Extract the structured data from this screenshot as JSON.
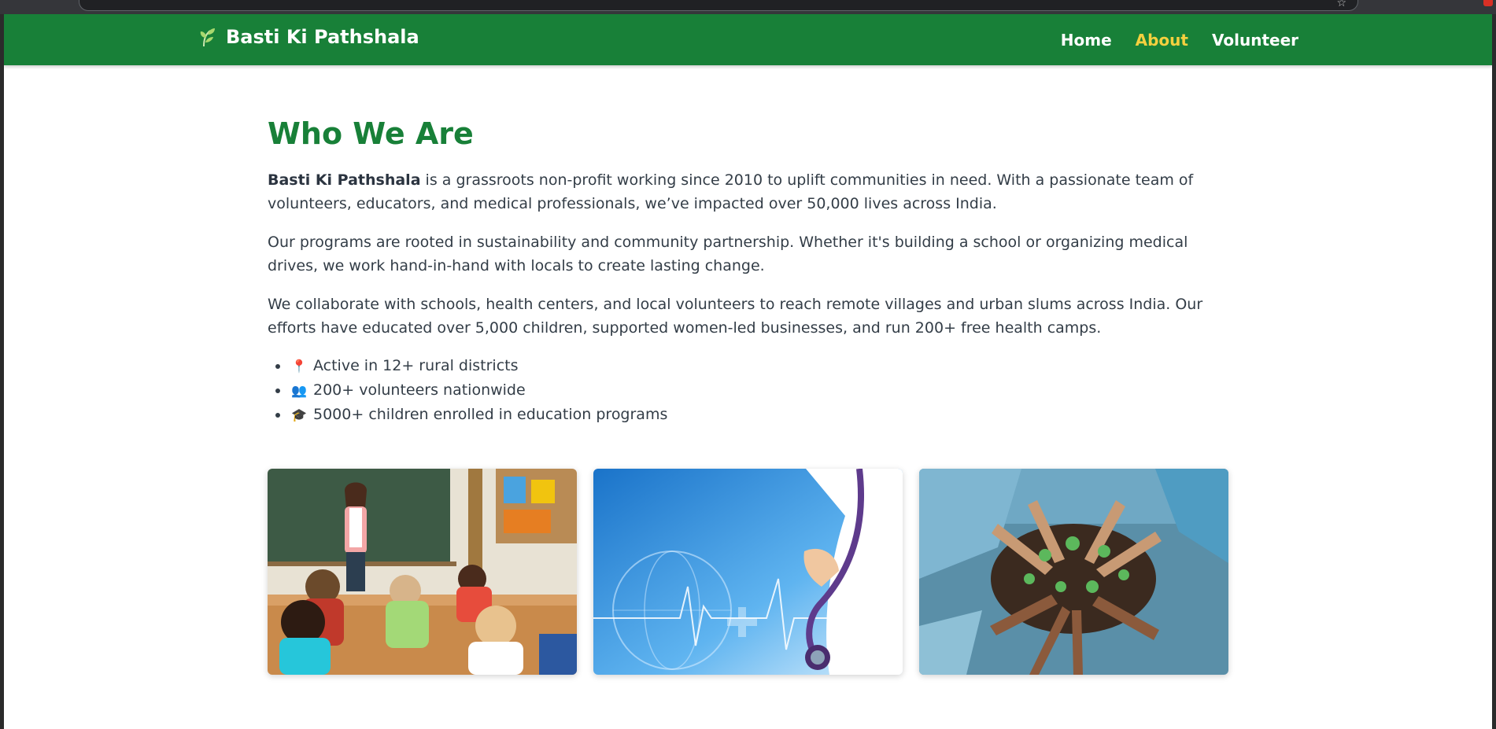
{
  "site": {
    "brand_name": "Basti Ki Pathshala",
    "brand_color": "#188038",
    "accent_color": "#f4d03f",
    "nav": [
      {
        "label": "Home",
        "active": false
      },
      {
        "label": "About",
        "active": true
      },
      {
        "label": "Volunteer",
        "active": false
      }
    ]
  },
  "about": {
    "heading": "Who We Are",
    "intro_bold": "Basti Ki Pathshala",
    "intro_rest": " is a grassroots non-profit working since 2010 to uplift communities in need. With a passionate team of volunteers, educators, and medical professionals, we’ve impacted over 50,000 lives across India.",
    "para2": "Our programs are rooted in sustainability and community partnership. Whether it's building a school or organizing medical drives, we work hand-in-hand with locals to create lasting change.",
    "para3": "We collaborate with schools, health centers, and local volunteers to reach remote villages and urban slums across India. Our efforts have educated over 5,000 children, supported women-led businesses, and run 200+ free health camps.",
    "highlights": [
      {
        "icon": "pin-icon",
        "emoji": "📍",
        "text": "Active in 12+ rural districts"
      },
      {
        "icon": "people-icon",
        "emoji": "👥",
        "text": "200+ volunteers nationwide"
      },
      {
        "icon": "graduation-cap-icon",
        "emoji": "🎓",
        "text": "5000+ children enrolled in education programs"
      }
    ]
  },
  "gallery": [
    {
      "name": "classroom-photo"
    },
    {
      "name": "medical-photo"
    },
    {
      "name": "volunteers-photo"
    }
  ]
}
